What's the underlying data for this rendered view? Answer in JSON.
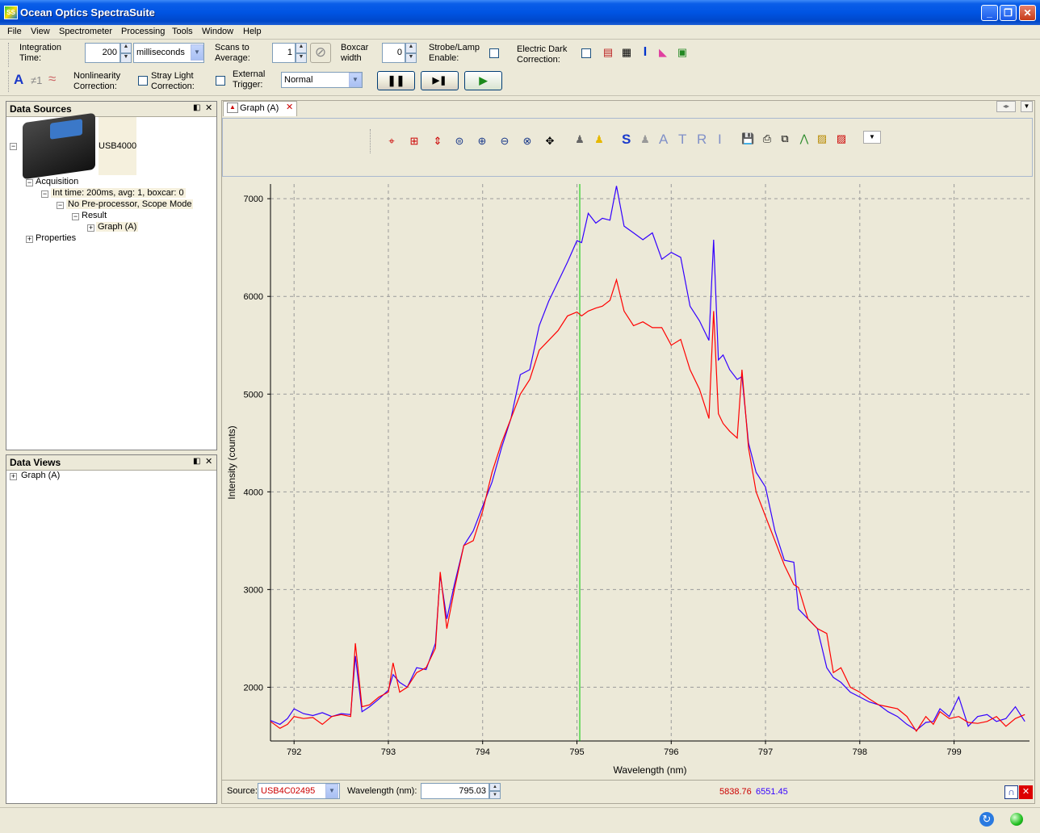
{
  "window": {
    "title": "Ocean Optics SpectraSuite",
    "app_icon_text": "SS"
  },
  "menu": [
    "File",
    "View",
    "Spectrometer",
    "Processing",
    "Tools",
    "Window",
    "Help"
  ],
  "toolbar": {
    "integration_time_label": "Integration\nTime:",
    "integration_time_value": "200",
    "integration_unit": "milliseconds",
    "scans_to_average_label": "Scans to\nAverage:",
    "scans_to_average_value": "1",
    "boxcar_label": "Boxcar\nwidth",
    "boxcar_value": "0",
    "strobe_label": "Strobe/Lamp\nEnable:",
    "electric_dark_label": "Electric Dark\nCorrection:",
    "nonlinearity_label": "Nonlinearity\nCorrection:",
    "stray_light_label": "Stray Light\nCorrection:",
    "external_trigger_label": "External\nTrigger:",
    "trigger_mode": "Normal",
    "text_a_glyph": "A",
    "not_one_glyph": "≠1"
  },
  "data_sources": {
    "title": "Data Sources",
    "device_name": "USB4000",
    "tree": [
      {
        "label": "Acquisition",
        "depth": 1
      },
      {
        "label": "Int time: 200ms, avg: 1, boxcar: 0",
        "depth": 2
      },
      {
        "label": "No Pre-processor, Scope Mode",
        "depth": 3
      },
      {
        "label": "Result",
        "depth": 4
      },
      {
        "label": "Graph (A)",
        "depth": 5
      },
      {
        "label": "Properties",
        "depth": 1
      }
    ]
  },
  "data_views": {
    "title": "Data Views",
    "items": [
      "Graph (A)"
    ]
  },
  "graph_tab": {
    "label": "Graph (A)"
  },
  "graph_toolbar": {
    "letters": [
      "S",
      "A",
      "T",
      "R",
      "I"
    ]
  },
  "status_bar": {
    "source_label": "Source:",
    "source_value": "USB4C02495",
    "wavelength_label": "Wavelength (nm):",
    "wavelength_value": "795.03",
    "cursor_red": "5838.76",
    "cursor_blue": "6551.45"
  },
  "colors": {
    "series_red": "#ff0000",
    "series_blue": "#3300ff",
    "cursor_line": "#00cc00",
    "title_bar": "#0054e3"
  },
  "chart_data": {
    "type": "line",
    "xlabel": "Wavelength (nm)",
    "ylabel": "Intensity (counts)",
    "xlim": [
      791.75,
      799.8
    ],
    "ylim": [
      1450,
      7150
    ],
    "xticks": [
      792,
      793,
      794,
      795,
      796,
      797,
      798,
      799
    ],
    "yticks": [
      2000,
      3000,
      4000,
      5000,
      6000,
      7000
    ],
    "grid": true,
    "cursor_x": 795.03,
    "series": [
      {
        "color": "#3300ff",
        "x": [
          791.75,
          791.85,
          791.93,
          792.0,
          792.1,
          792.2,
          792.3,
          792.4,
          792.5,
          792.6,
          792.65,
          792.72,
          792.8,
          792.9,
          793.0,
          793.05,
          793.12,
          793.2,
          793.3,
          793.4,
          793.5,
          793.55,
          793.62,
          793.7,
          793.8,
          793.9,
          794.0,
          794.1,
          794.2,
          794.3,
          794.4,
          794.5,
          794.6,
          794.7,
          794.8,
          794.9,
          795.0,
          795.05,
          795.12,
          795.2,
          795.27,
          795.35,
          795.42,
          795.5,
          795.6,
          795.7,
          795.8,
          795.9,
          796.0,
          796.1,
          796.2,
          796.3,
          796.4,
          796.45,
          796.5,
          796.55,
          796.62,
          796.7,
          796.75,
          796.82,
          796.9,
          797.0,
          797.1,
          797.2,
          797.3,
          797.35,
          797.45,
          797.55,
          797.65,
          797.72,
          797.8,
          797.9,
          798.0,
          798.1,
          798.2,
          798.3,
          798.4,
          798.5,
          798.6,
          798.7,
          798.78,
          798.85,
          798.95,
          799.05,
          799.15,
          799.25,
          799.35,
          799.45,
          799.55,
          799.65,
          799.75
        ],
        "y": [
          1660,
          1620,
          1680,
          1780,
          1730,
          1710,
          1740,
          1700,
          1730,
          1720,
          2320,
          1750,
          1800,
          1880,
          1970,
          2130,
          2050,
          2000,
          2200,
          2180,
          2450,
          3150,
          2700,
          3050,
          3450,
          3600,
          3850,
          4100,
          4450,
          4750,
          5200,
          5250,
          5700,
          5950,
          6150,
          6350,
          6570,
          6550,
          6850,
          6750,
          6800,
          6780,
          7130,
          6720,
          6650,
          6580,
          6650,
          6380,
          6450,
          6400,
          5900,
          5750,
          5550,
          6580,
          5350,
          5400,
          5250,
          5150,
          5180,
          4500,
          4200,
          4050,
          3600,
          3300,
          3280,
          2800,
          2700,
          2600,
          2200,
          2100,
          2050,
          1950,
          1900,
          1850,
          1820,
          1750,
          1700,
          1620,
          1560,
          1640,
          1650,
          1780,
          1700,
          1900,
          1600,
          1700,
          1720,
          1650,
          1680,
          1800,
          1650
        ]
      },
      {
        "color": "#ff0000",
        "x": [
          791.75,
          791.85,
          791.93,
          792.0,
          792.1,
          792.2,
          792.3,
          792.4,
          792.5,
          792.6,
          792.65,
          792.72,
          792.8,
          792.9,
          793.0,
          793.05,
          793.12,
          793.2,
          793.3,
          793.4,
          793.5,
          793.55,
          793.62,
          793.7,
          793.8,
          793.9,
          794.0,
          794.1,
          794.2,
          794.3,
          794.4,
          794.5,
          794.6,
          794.7,
          794.8,
          794.9,
          795.0,
          795.05,
          795.12,
          795.2,
          795.27,
          795.35,
          795.42,
          795.5,
          795.6,
          795.7,
          795.8,
          795.9,
          796.0,
          796.1,
          796.2,
          796.3,
          796.4,
          796.45,
          796.5,
          796.55,
          796.62,
          796.7,
          796.75,
          796.82,
          796.9,
          797.0,
          797.1,
          797.2,
          797.3,
          797.35,
          797.45,
          797.55,
          797.65,
          797.72,
          797.8,
          797.9,
          798.0,
          798.1,
          798.2,
          798.3,
          798.4,
          798.5,
          798.6,
          798.7,
          798.78,
          798.85,
          798.95,
          799.05,
          799.15,
          799.25,
          799.35,
          799.45,
          799.55,
          799.65,
          799.75
        ],
        "y": [
          1650,
          1580,
          1620,
          1700,
          1680,
          1690,
          1620,
          1700,
          1720,
          1700,
          2450,
          1800,
          1820,
          1900,
          1950,
          2250,
          1950,
          2000,
          2150,
          2200,
          2400,
          3180,
          2600,
          3000,
          3450,
          3500,
          3800,
          4200,
          4500,
          4750,
          5000,
          5150,
          5450,
          5550,
          5650,
          5800,
          5840,
          5800,
          5850,
          5880,
          5900,
          5960,
          6170,
          5850,
          5700,
          5740,
          5680,
          5680,
          5500,
          5560,
          5250,
          5050,
          4750,
          5850,
          4800,
          4700,
          4620,
          4550,
          5250,
          4450,
          4000,
          3750,
          3500,
          3250,
          3050,
          3020,
          2700,
          2600,
          2550,
          2150,
          2200,
          2000,
          1950,
          1880,
          1820,
          1800,
          1780,
          1700,
          1550,
          1700,
          1620,
          1750,
          1680,
          1700,
          1640,
          1630,
          1650,
          1700,
          1600,
          1680,
          1720
        ]
      }
    ]
  }
}
